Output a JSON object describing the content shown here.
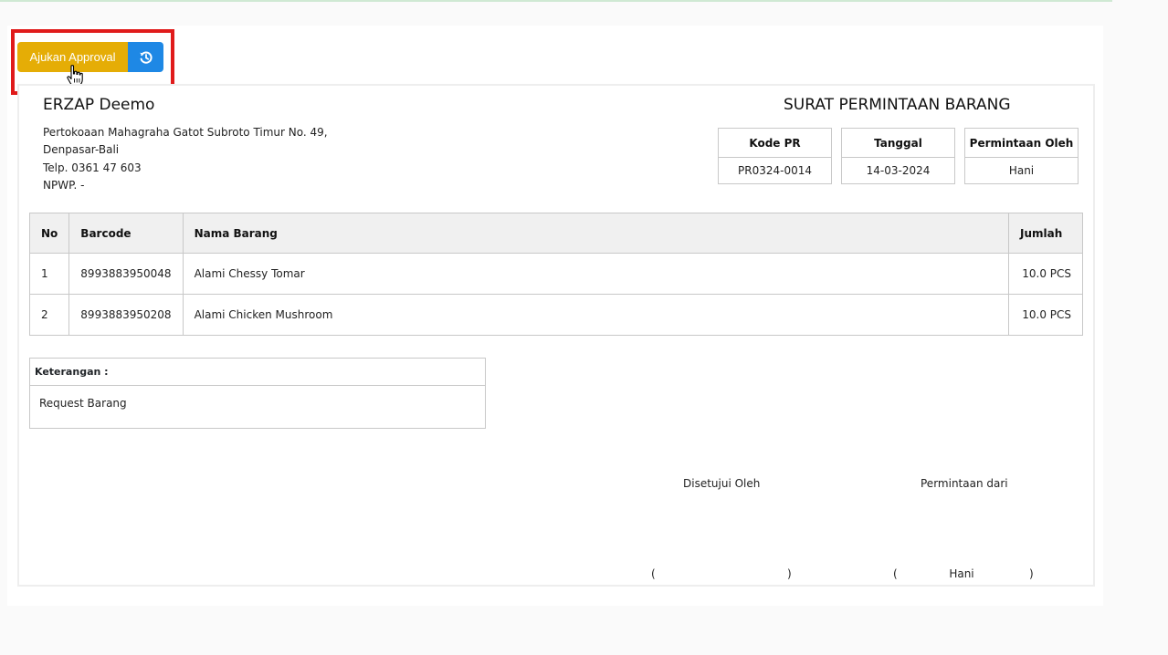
{
  "actions": {
    "approve_label": "Ajukan Approval",
    "history_icon": "history-icon"
  },
  "company": {
    "name": "ERZAP Deemo",
    "address1": "Pertokoaan Mahagraha Gatot Subroto Timur No. 49,",
    "address2": "Denpasar-Bali",
    "phone": "Telp. 0361 47 603",
    "npwp": "NPWP. -"
  },
  "document": {
    "title": "SURAT PERMINTAAN BARANG",
    "info": [
      {
        "label": "Kode PR",
        "value": "PR0324-0014"
      },
      {
        "label": "Tanggal",
        "value": "14-03-2024"
      },
      {
        "label": "Permintaan Oleh",
        "value": "Hani"
      }
    ]
  },
  "table": {
    "headers": [
      "No",
      "Barcode",
      "Nama Barang",
      "Jumlah"
    ],
    "rows": [
      [
        "1",
        "8993883950048",
        "Alami Chessy Tomar",
        "10.0 PCS"
      ],
      [
        "2",
        "8993883950208",
        "Alami Chicken Mushroom",
        "10.0 PCS"
      ]
    ]
  },
  "note": {
    "label": "Keterangan :",
    "value": "Request Barang"
  },
  "signatures": {
    "approved_label": "Disetujui Oleh",
    "requested_label": "Permintaan dari",
    "approved_name": "",
    "requested_name": "Hani",
    "open_paren": "(",
    "close_paren": ")"
  },
  "colors": {
    "approve": "#e5ad06",
    "history": "#1e88e5",
    "highlight": "#e01b1b"
  }
}
